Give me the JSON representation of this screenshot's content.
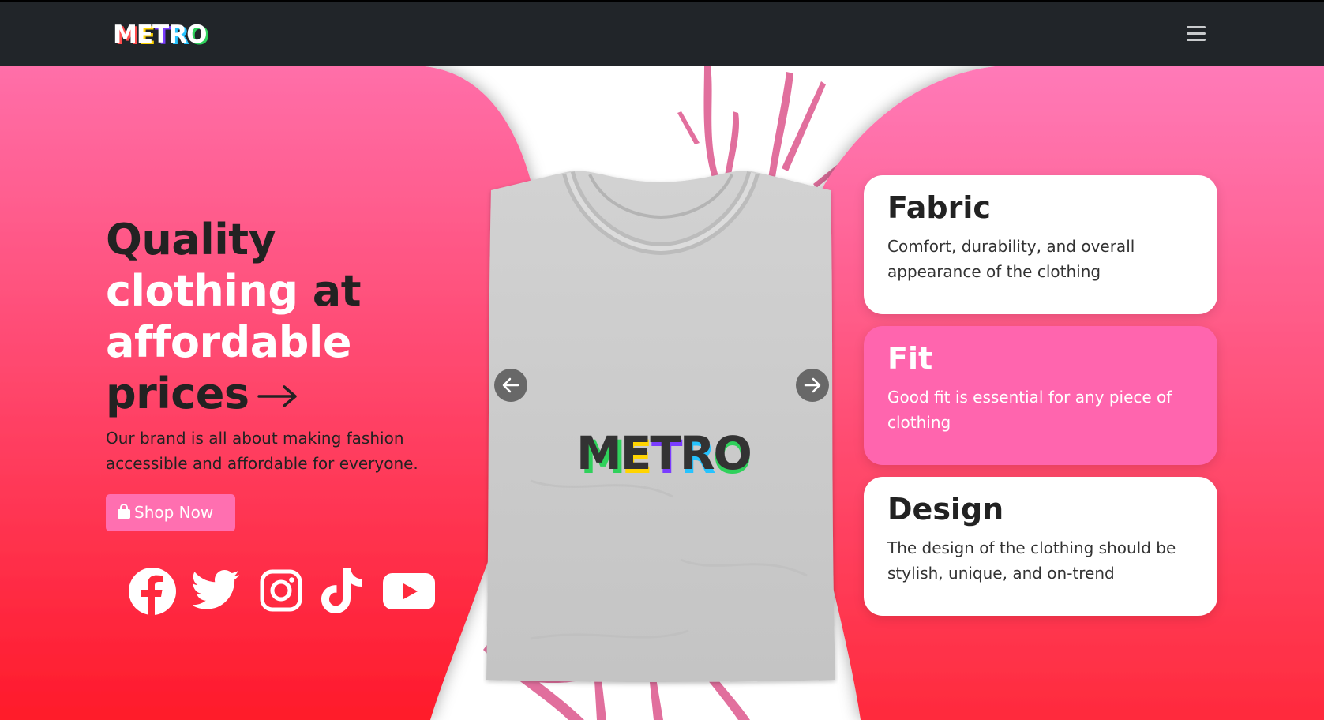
{
  "navbar": {
    "brand_letters": [
      "M",
      "E",
      "T",
      "R",
      "O"
    ],
    "brand_colors": [
      "#ffffff",
      "#ffffff",
      "#ffffff",
      "#ffffff",
      "#ffffff"
    ],
    "brand_shadow_colors": [
      "#ff4d4d",
      "#ffd400",
      "#7a3cff",
      "#25c3ff",
      "#2fd15b"
    ],
    "menu_icon": "hamburger-icon"
  },
  "hero": {
    "headline_line1": "Quality",
    "headline_line2a": "clothing",
    "headline_line2b": "at",
    "headline_line3": "affordable",
    "headline_line4": "prices",
    "subtext": "Our brand is all about making fashion accessible and affordable for everyone.",
    "shop_button_label": "Shop Now",
    "shop_button_icon": "shopping-bag-icon",
    "socials": [
      "facebook-icon",
      "twitter-icon",
      "instagram-icon",
      "tiktok-icon",
      "youtube-icon"
    ]
  },
  "carousel": {
    "shirt_print": "METRO",
    "prev_icon": "arrow-left-icon",
    "next_icon": "arrow-right-icon"
  },
  "features": [
    {
      "title": "Fabric",
      "description": "Comfort, durability, and overall appearance of the clothing"
    },
    {
      "title": "Fit",
      "description": "Good fit is essential for any piece of clothing"
    },
    {
      "title": "Design",
      "description": "The design of the clothing should be stylish, unique, and on-trend"
    }
  ],
  "colors": {
    "navbar_bg": "#212529",
    "hero_gradient_top": "#ff6fa9",
    "hero_gradient_bottom": "#ff1a2a",
    "accent_pink": "#ff65ae",
    "text_dark": "#222222"
  }
}
